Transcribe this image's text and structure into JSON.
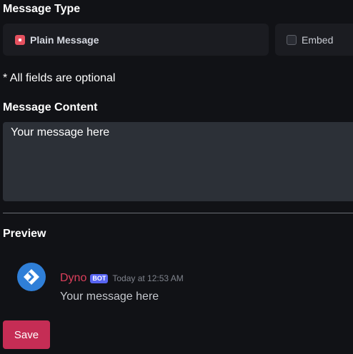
{
  "message_type": {
    "title": "Message Type",
    "options": [
      {
        "label": "Plain Message",
        "selected": true
      },
      {
        "label": "Embed",
        "selected": false
      }
    ]
  },
  "optional_note": "* All fields are optional",
  "message_content": {
    "title": "Message Content",
    "value": "Your message here"
  },
  "preview": {
    "title": "Preview",
    "bot_name": "Dyno",
    "bot_tag": "BOT",
    "timestamp": "Today at 12:53 AM",
    "message_text": "Your message here",
    "avatar_icon": "dyno-logo-icon"
  },
  "save_label": "Save",
  "colors": {
    "accent": "#c52d55",
    "bot_name": "#dc3f5b",
    "bot_tag": "#5865f2",
    "avatar": "#2f7fd8",
    "radio_selected": "#e5515f"
  }
}
